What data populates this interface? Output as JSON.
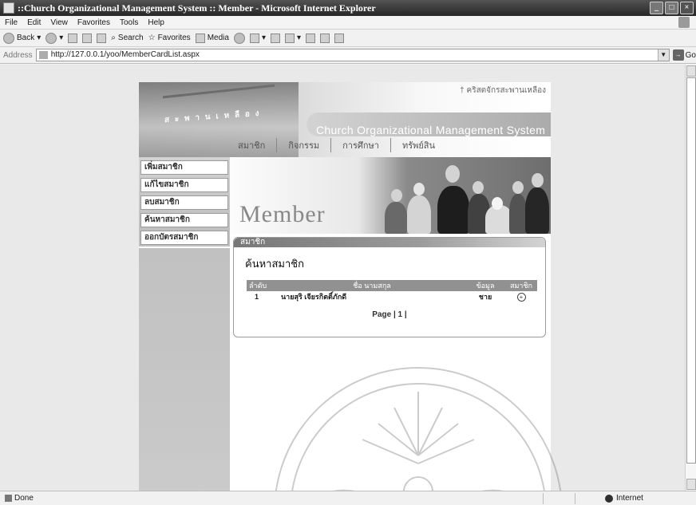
{
  "window": {
    "title": "::Church Organizational Management System :: Member - Microsoft Internet Explorer"
  },
  "menubar": {
    "items": [
      "File",
      "Edit",
      "View",
      "Favorites",
      "Tools",
      "Help"
    ]
  },
  "toolbar": {
    "back": "Back",
    "search": "Search",
    "favorites": "Favorites",
    "media": "Media"
  },
  "address": {
    "label": "Address",
    "url": "http://127.0.0.1/yoo/MemberCardList.aspx",
    "go": "Go"
  },
  "header": {
    "tagline": "† คริสตจักรสะพานเหลือง",
    "system_name": "Church Organizational Management System",
    "nav": [
      "สมาชิก",
      "กิจกรรม",
      "การศึกษา",
      "ทรัพย์สิน"
    ]
  },
  "sidebar": {
    "items": [
      "เพิ่มสมาชิก",
      "แก้ไขสมาชิก",
      "ลบสมาชิก",
      "ค้นหาสมาชิก",
      "ออกบัตรสมาชิก"
    ]
  },
  "banner": {
    "title": "Member"
  },
  "panel": {
    "header": "สมาชิก",
    "title": "ค้นหาสมาชิก"
  },
  "table": {
    "columns": [
      "ลำดับ",
      "ชื่อ นามสกุล",
      "ข้อมูล",
      "สมาชิก"
    ],
    "rows": [
      {
        "no": "1",
        "name": "นายสุริ เจียรกิตติ์ภักดี",
        "gender": "ชาย"
      }
    ]
  },
  "pager": {
    "text": "Page | 1 |"
  },
  "status": {
    "left": "Done",
    "zone": "Internet"
  },
  "colors": {
    "chrome": "#ececec",
    "table_header": "#909090"
  }
}
